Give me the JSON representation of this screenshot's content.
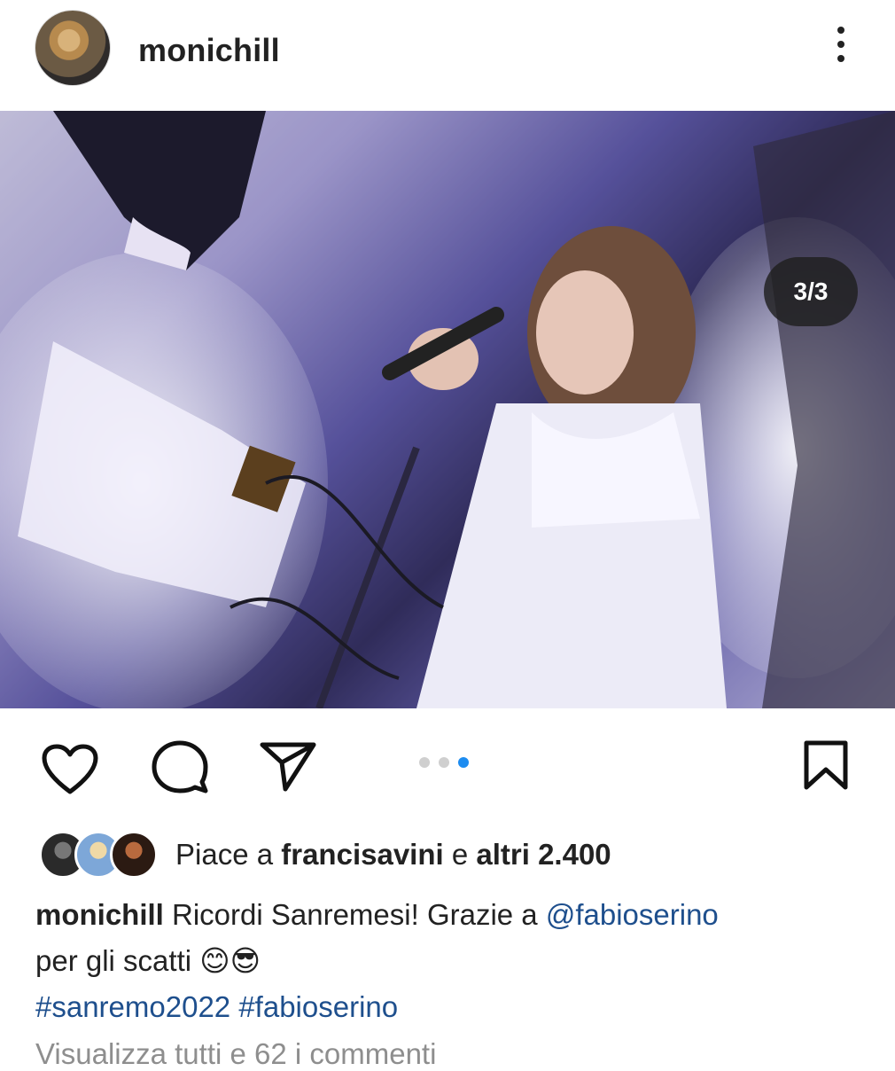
{
  "post": {
    "username": "monichill",
    "image_counter": "3/3",
    "carousel": {
      "count": 3,
      "active": 3
    },
    "likes": {
      "prefix": "Piace a",
      "user": "francisavini",
      "joiner": "e",
      "others": "altri 2.400"
    },
    "caption": {
      "username": "monichill",
      "text": "Ricordi Sanremesi! Grazie a",
      "mention": "@fabioserino",
      "text2": "per gli scatti",
      "emoji": "😊😎",
      "hashtags": [
        "#sanremo2022",
        "#fabioserino"
      ]
    },
    "view_comments": "Visualizza tutti e 62 i commenti"
  },
  "icons": [
    "more-options-icon",
    "heart-icon",
    "comment-icon",
    "share-icon",
    "bookmark-icon"
  ],
  "colors": {
    "link": "#1e4f8d",
    "active_dot": "#1d8cf0",
    "muted": "#8e8e8e"
  }
}
